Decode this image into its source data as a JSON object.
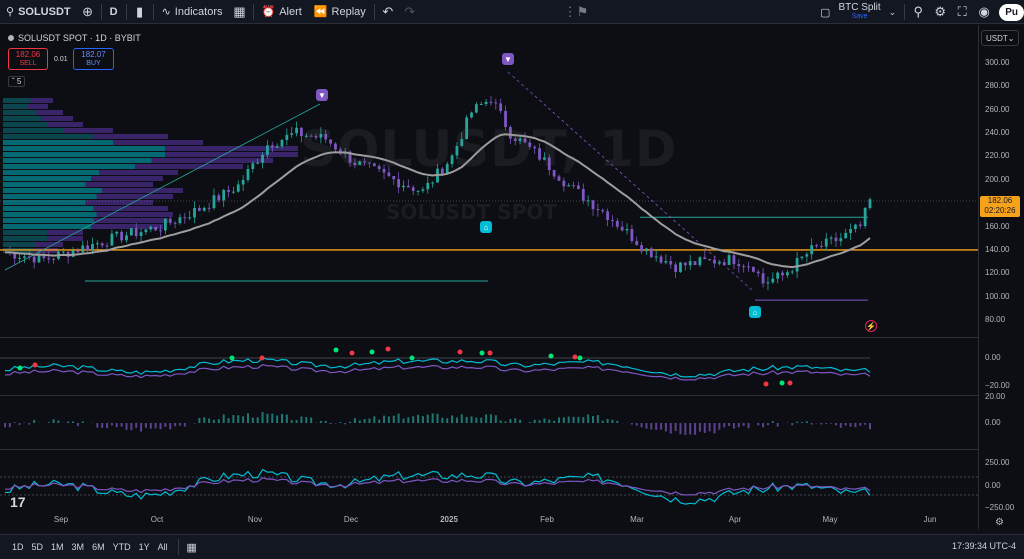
{
  "toolbar": {
    "symbol": "SOLUSDT",
    "interval": "D",
    "indicators_label": "Indicators",
    "alert_label": "Alert",
    "replay_label": "Replay",
    "layout_name": "BTC Split",
    "layout_status": "Save",
    "publish_label": "Pu"
  },
  "legend": {
    "title": "SOLUSDT SPOT · 1D · BYBIT",
    "sell_price": "182.06",
    "sell_label": "SELL",
    "spread": "0.01",
    "buy_price": "182.07",
    "buy_label": "BUY",
    "indicators_count": "5"
  },
  "currency": "USDT",
  "watermark": {
    "main": "SOLUSDT, 1D",
    "sub": "SOLUSDT SPOT"
  },
  "last_price": {
    "value": "182.06",
    "countdown": "02:20:26"
  },
  "price_axis": [
    "300.00",
    "280.00",
    "260.00",
    "240.00",
    "220.00",
    "200.00",
    "180.00",
    "160.00",
    "140.00",
    "120.00",
    "100.00",
    "80.00"
  ],
  "osc1_axis": [
    "0.00",
    "−20.00"
  ],
  "osc2_axis": [
    "20.00",
    "0.00"
  ],
  "osc3_axis": [
    "250.00",
    "0.00",
    "−250.00"
  ],
  "time_axis": [
    "Sep",
    "Oct",
    "Nov",
    "Dec",
    "2025",
    "Feb",
    "Mar",
    "Apr",
    "May",
    "Jun"
  ],
  "ranges": [
    "1D",
    "5D",
    "1M",
    "3M",
    "6M",
    "YTD",
    "1Y",
    "All"
  ],
  "clock": "17:39:34 UTC-4",
  "colors": {
    "bull": "#26a69a",
    "bear": "#7e57c2",
    "support": "#f7a21b",
    "ema": "#9e9e9e"
  },
  "chart_data": {
    "type": "candlestick",
    "y_range": [
      70,
      310
    ],
    "x": [
      "Sep",
      "Oct",
      "Nov",
      "Dec",
      "2025",
      "Feb",
      "Mar",
      "Apr",
      "May",
      "Jun"
    ],
    "close_path": [
      [
        0,
        138
      ],
      [
        4,
        132
      ],
      [
        8,
        142
      ],
      [
        12,
        152
      ],
      [
        16,
        160
      ],
      [
        20,
        175
      ],
      [
        24,
        195
      ],
      [
        27,
        230
      ],
      [
        30,
        240
      ],
      [
        33,
        235
      ],
      [
        36,
        215
      ],
      [
        40,
        200
      ],
      [
        43,
        190
      ],
      [
        46,
        220
      ],
      [
        48,
        258
      ],
      [
        50,
        270
      ],
      [
        52,
        240
      ],
      [
        55,
        220
      ],
      [
        58,
        195
      ],
      [
        62,
        170
      ],
      [
        64,
        155
      ],
      [
        66,
        140
      ],
      [
        69,
        126
      ],
      [
        72,
        130
      ],
      [
        75,
        132
      ],
      [
        77,
        126
      ],
      [
        78,
        112
      ],
      [
        80,
        118
      ],
      [
        83,
        140
      ],
      [
        86,
        150
      ],
      [
        88,
        160
      ],
      [
        89,
        182
      ]
    ],
    "horizontal_levels": [
      140,
      168,
      97
    ],
    "ema_label": ""
  }
}
